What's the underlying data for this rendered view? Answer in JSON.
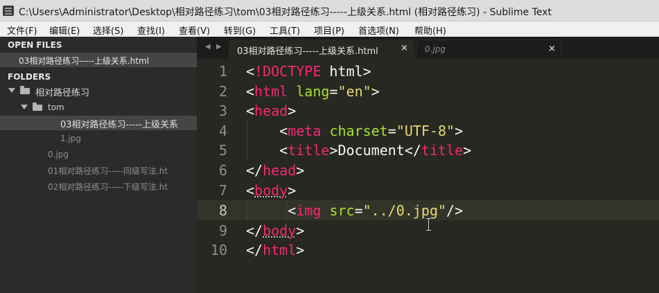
{
  "window": {
    "title": "C:\\Users\\Administrator\\Desktop\\相对路径练习\\tom\\03相对路径练习-----上级关系.html (相对路径练习) - Sublime Text"
  },
  "menu": [
    "文件(F)",
    "编辑(E)",
    "选择(S)",
    "查找(I)",
    "查看(V)",
    "转到(G)",
    "工具(T)",
    "项目(P)",
    "首选项(N)",
    "帮助(H)"
  ],
  "sidebar": {
    "open_files_label": "OPEN FILES",
    "open_files": [
      "03相对路径练习-----上级关系.html"
    ],
    "folders_label": "FOLDERS",
    "root_folder": "相对路径练习",
    "sub_folder": "tom",
    "sub_files": [
      "03相对路径练习-----上级关系",
      "1.jpg"
    ],
    "root_files": [
      "0.jpg",
      "01相对路径练习-----同级写法.ht",
      "02相对路径练习-----下级写法.ht"
    ]
  },
  "tabs": {
    "active": "03相对路径练习-----上级关系.html",
    "inactive": "0.jpg",
    "close_glyph": "×",
    "nav_left": "◀",
    "nav_right": "▶"
  },
  "editor": {
    "line_numbers": [
      "1",
      "2",
      "3",
      "4",
      "5",
      "6",
      "7",
      "8",
      "9",
      "10"
    ],
    "lines": [
      "<!DOCTYPE html>",
      "<html lang=\"en\">",
      "<head>",
      "    <meta charset=\"UTF-8\">",
      "    <title>Document</title>",
      "</head>",
      "<body>",
      "     <img src=\"../0.jpg\"/>",
      "</body>",
      "</html>"
    ],
    "tokens": {
      "lt": "<",
      "gt": ">",
      "close_lt": "</",
      "self_close": "/>",
      "eq": "=",
      "doctype": "!DOCTYPE",
      "doctype_rest": " html",
      "html": "html",
      "lang": "lang",
      "en": "\"en\"",
      "head": "head",
      "meta": "meta",
      "charset": "charset",
      "utf8": "\"UTF-8\"",
      "title": "title",
      "document": "Document",
      "body": "body",
      "img": "img",
      "src": "src",
      "src_val": "\"../0.jpg\""
    }
  },
  "colors": {
    "tag": "#f92672",
    "attribute": "#a6e22e",
    "string": "#e6db74",
    "text": "#f8f8f2",
    "background": "#272822",
    "sidebar": "#2b2b2b"
  }
}
